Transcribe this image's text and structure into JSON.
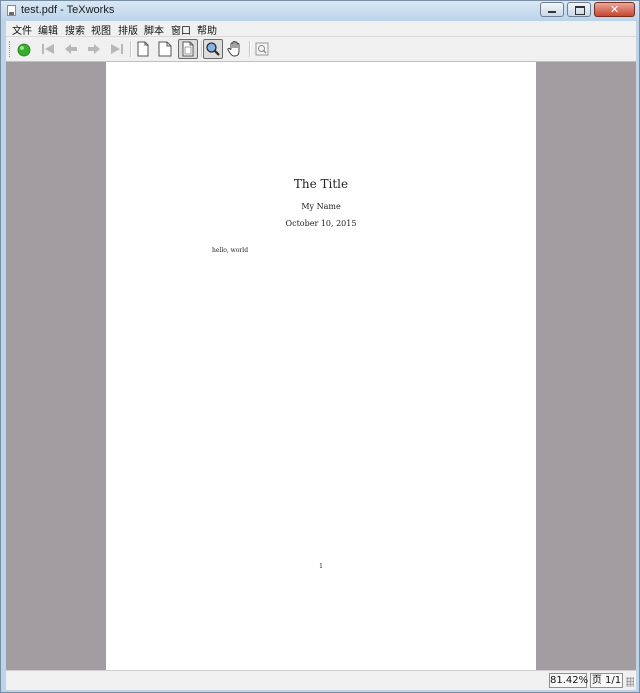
{
  "window": {
    "title": "test.pdf - TeXworks"
  },
  "menubar": {
    "items": [
      "文件",
      "编辑",
      "搜索",
      "视图",
      "排版",
      "脚本",
      "窗口",
      "帮助"
    ]
  },
  "toolbar": {
    "buttons": [
      {
        "icon": "typeset-green-circle-icon"
      },
      {
        "icon": "first-page-icon"
      },
      {
        "icon": "previous-page-icon"
      },
      {
        "icon": "next-page-icon"
      },
      {
        "icon": "last-page-icon"
      },
      {
        "icon": "actual-size-page-icon"
      },
      {
        "icon": "fit-width-page-icon"
      },
      {
        "icon": "fit-window-page-icon",
        "active": true
      },
      {
        "icon": "magnify-tool-icon",
        "active": true
      },
      {
        "icon": "pan-hand-tool-icon"
      },
      {
        "icon": "find-icon"
      }
    ]
  },
  "document": {
    "title": "The Title",
    "author": "My Name",
    "date": "October 10, 2015",
    "body": "hello, world",
    "page_number": "1"
  },
  "status": {
    "zoom": "81.42%",
    "page": "页 1/1"
  },
  "colors": {
    "viewport_background": "#a39da2",
    "typeset_green": "#35b02a",
    "chrome": "#f0f0f0"
  }
}
